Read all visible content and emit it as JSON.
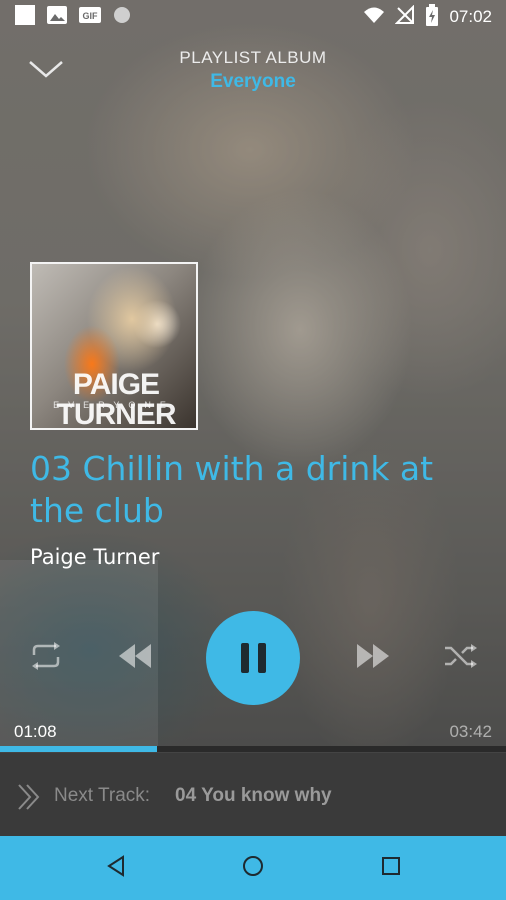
{
  "status_bar": {
    "time": "07:02",
    "icons": [
      "notification-square-icon",
      "image-icon",
      "gif-icon",
      "circle-icon",
      "wifi-icon",
      "no-signal-icon",
      "battery-charging-icon"
    ]
  },
  "header": {
    "title": "PLAYLIST ALBUM",
    "subtitle": "Everyone"
  },
  "album_art": {
    "artist_text": "PAIGE TURNER",
    "album_text": "EVERYONE"
  },
  "track": {
    "title": "03 Chillin with a drink at the club",
    "artist": "Paige Turner"
  },
  "controls": {
    "repeat": "repeat-icon",
    "previous": "rewind-icon",
    "play_pause": "pause-icon",
    "next": "fast-forward-icon",
    "shuffle": "shuffle-icon"
  },
  "playback": {
    "elapsed": "01:08",
    "total": "03:42",
    "progress_fraction": 0.31
  },
  "next_track": {
    "label": "Next Track:",
    "value": "04 You know why"
  },
  "colors": {
    "accent": "#3fb9e6",
    "next_bar_bg": "#3a3a3a"
  }
}
